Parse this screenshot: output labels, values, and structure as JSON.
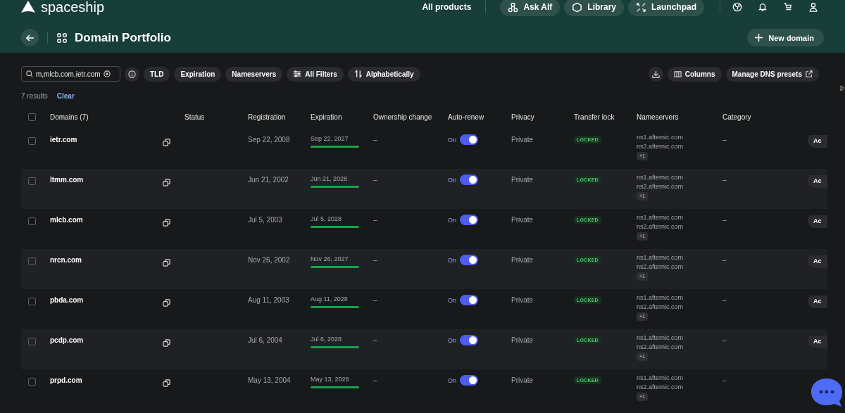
{
  "topbar": {
    "logo": "spaceship",
    "nav": [
      {
        "label": "All products",
        "kind": "link"
      },
      {
        "label": "Ask Alf",
        "kind": "pill"
      },
      {
        "label": "Library",
        "kind": "pill"
      },
      {
        "label": "Launchpad",
        "kind": "pill"
      }
    ]
  },
  "page": {
    "title": "Domain Portfolio",
    "new_button": "New domain"
  },
  "filters": {
    "search_value": "m,mlcb.com,ietr.com",
    "chips": [
      "TLD",
      "Expiration",
      "Nameservers",
      "All Filters",
      "Alphabetically"
    ],
    "columns_button": "Columns",
    "dns_button": "Manage DNS presets"
  },
  "results": {
    "count": "7 results",
    "clear": "Clear"
  },
  "table": {
    "all_checked": false,
    "columns": [
      "Domains (7)",
      "Status",
      "Registration",
      "Expiration",
      "Ownership change",
      "Auto-renew",
      "Privacy",
      "Transfer lock",
      "Nameservers",
      "Category"
    ],
    "rows": [
      {
        "checked": false,
        "domain": "ietr.com",
        "registration": "Sep 22, 2008",
        "expiration": "Sep 22, 2027",
        "ownership": "–",
        "auto_renew": true,
        "auto_label": "On",
        "privacy": "Private",
        "lock": "LOCKED",
        "ns": [
          "ns1.afternic.com",
          "ns2.afternic.com"
        ],
        "ns_more": "+1",
        "category": "–",
        "action": "Ac"
      },
      {
        "checked": false,
        "domain": "ltmm.com",
        "registration": "Jun 21, 2002",
        "expiration": "Jun 21, 2028",
        "ownership": "–",
        "auto_renew": true,
        "auto_label": "On",
        "privacy": "Private",
        "lock": "LOCKED",
        "ns": [
          "ns1.afternic.com",
          "ns2.afternic.com"
        ],
        "ns_more": "+1",
        "category": "–",
        "action": "Ac"
      },
      {
        "checked": false,
        "domain": "mlcb.com",
        "registration": "Jul 5, 2003",
        "expiration": "Jul 5, 2028",
        "ownership": "–",
        "auto_renew": true,
        "auto_label": "On",
        "privacy": "Private",
        "lock": "LOCKED",
        "ns": [
          "ns1.afternic.com",
          "ns2.afternic.com"
        ],
        "ns_more": "+1",
        "category": "–",
        "action": "Ac"
      },
      {
        "checked": false,
        "domain": "nrcn.com",
        "registration": "Nov 26, 2002",
        "expiration": "Nov 26, 2027",
        "ownership": "–",
        "auto_renew": true,
        "auto_label": "On",
        "privacy": "Private",
        "lock": "LOCKED",
        "ns": [
          "ns1.afternic.com",
          "ns2.afternic.com"
        ],
        "ns_more": "+1",
        "category": "–",
        "action": "Ac"
      },
      {
        "checked": false,
        "domain": "pbda.com",
        "registration": "Aug 11, 2003",
        "expiration": "Aug 11, 2028",
        "ownership": "–",
        "auto_renew": true,
        "auto_label": "On",
        "privacy": "Private",
        "lock": "LOCKED",
        "ns": [
          "ns1.afternic.com",
          "ns2.afternic.com"
        ],
        "ns_more": "+1",
        "category": "–",
        "action": "Ac"
      },
      {
        "checked": false,
        "domain": "pcdp.com",
        "registration": "Jul 6, 2004",
        "expiration": "Jul 6, 2028",
        "ownership": "–",
        "auto_renew": true,
        "auto_label": "On",
        "privacy": "Private",
        "lock": "LOCKED",
        "ns": [
          "ns1.afternic.com",
          "ns2.afternic.com"
        ],
        "ns_more": "+1",
        "category": "–",
        "action": "Ac"
      },
      {
        "checked": false,
        "domain": "prpd.com",
        "registration": "May 13, 2004",
        "expiration": "May 13, 2028",
        "ownership": "–",
        "auto_renew": true,
        "auto_label": "On",
        "privacy": "Private",
        "lock": "LOCKED",
        "ns": [
          "ns1.afternic.com",
          "ns2.afternic.com"
        ],
        "ns_more": "+1",
        "category": "–"
      }
    ]
  }
}
